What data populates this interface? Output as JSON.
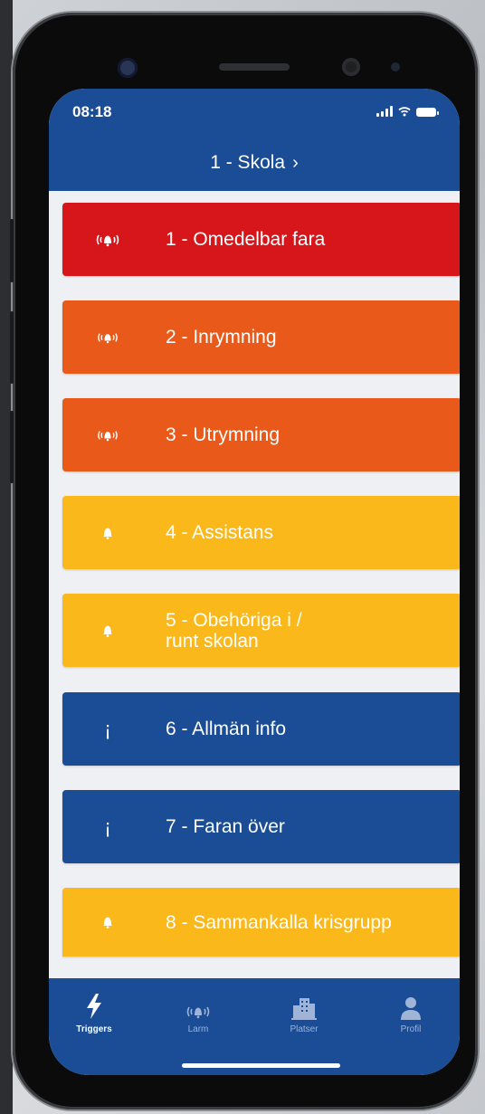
{
  "status_bar": {
    "time": "08:18"
  },
  "header": {
    "title": "1 - Skola",
    "chevron": "›"
  },
  "colors": {
    "header_blue": "#1a4d96",
    "red": "#d6161a",
    "orange": "#e95a1a",
    "yellow": "#fbb81a",
    "blue": "#1a4d96"
  },
  "triggers": [
    {
      "label": "1 - Omedelbar fara",
      "icon": "alarm-bell-icon",
      "color": "#d6161a"
    },
    {
      "label": "2 - Inrymning",
      "icon": "alarm-bell-icon",
      "color": "#e95a1a"
    },
    {
      "label": "3 - Utrymning",
      "icon": "alarm-bell-icon",
      "color": "#e95a1a"
    },
    {
      "label": "4 - Assistans",
      "icon": "bell-icon",
      "color": "#fbb81a"
    },
    {
      "label": "5 - Obehöriga i /\nrunt skolan",
      "icon": "bell-icon",
      "color": "#fbb81a"
    },
    {
      "label": "6 - Allmän info",
      "icon": "info-icon",
      "glyph": "¡",
      "color": "#1a4d96"
    },
    {
      "label": "7 - Faran över",
      "icon": "info-icon",
      "glyph": "¡",
      "color": "#1a4d96"
    },
    {
      "label": "8 - Sammankalla krisgrupp",
      "icon": "bell-icon",
      "color": "#fbb81a"
    }
  ],
  "tabs": [
    {
      "label": "Triggers",
      "icon": "lightning-icon",
      "active": true
    },
    {
      "label": "Larm",
      "icon": "alarm-bell-icon",
      "active": false
    },
    {
      "label": "Platser",
      "icon": "buildings-icon",
      "active": false
    },
    {
      "label": "Profil",
      "icon": "person-icon",
      "active": false
    }
  ]
}
